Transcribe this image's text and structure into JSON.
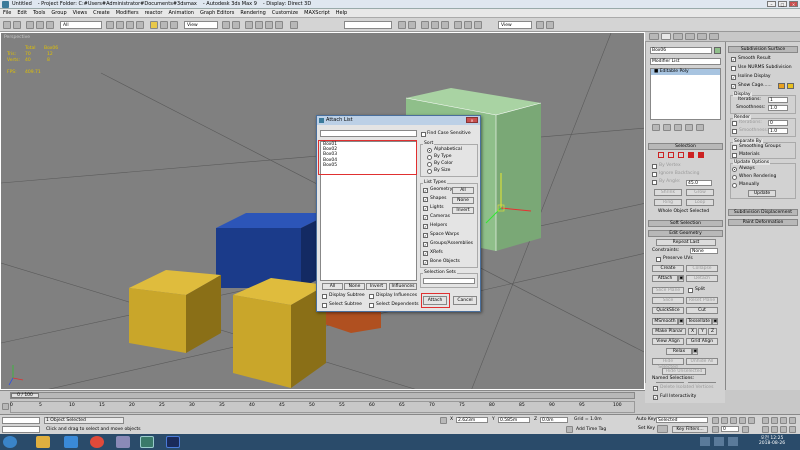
{
  "window": {
    "title_parts": [
      "Untitled",
      "- Project Folder: C:#Users#Administrator#Documents#3dsmax",
      "- Autodesk 3ds Max 9",
      "- Display: Direct 3D"
    ]
  },
  "menu": [
    "File",
    "Edit",
    "Tools",
    "Group",
    "Views",
    "Create",
    "Modifiers",
    "reactor",
    "Animation",
    "Graph Editors",
    "Rendering",
    "Customize",
    "MAXScript",
    "Help"
  ],
  "toolbar": {
    "selection_filter": "All",
    "ref_coord": "View",
    "named_set": "",
    "view_right": "View"
  },
  "viewport": {
    "label": "Perspective",
    "stats": {
      "total_label": "Total",
      "object_name": "Box06",
      "tris_label": "Tris:",
      "tris_total": "70",
      "tris_sel": "12",
      "verts_label": "Verts:",
      "verts_total": "40",
      "verts_sel": "8",
      "fps_label": "FPS:",
      "fps_value": "409.71"
    }
  },
  "modify_panel": {
    "object_name": "Box06",
    "modifier_list": "Modifier List",
    "stack_item": "Editable Poly",
    "selection_title": "Selection",
    "by_vertex": "By Vertex",
    "ignore_backfacing": "Ignore Backfacing",
    "by_angle": "By Angle:",
    "by_angle_value": "45.0",
    "shrink": "Shrink",
    "grow": "Grow",
    "ring": "Ring",
    "loop": "Loop",
    "selection_status": "Whole Object Selected",
    "soft_selection": "Soft Selection",
    "edit_geometry": "Edit Geometry",
    "repeat_last": "Repeat Last",
    "constraints_label": "Constraints:",
    "constraints_value": "None",
    "preserve_uvs": "Preserve UVs",
    "create": "Create",
    "collapse": "Collapse",
    "attach": "Attach",
    "detach": "Detach",
    "slice_plane": "Slice Plane",
    "split": "Split",
    "slice": "Slice",
    "reset_plane": "Reset Plane",
    "quickslice": "QuickSlice",
    "cut": "Cut",
    "msmooth": "MSmooth",
    "tessellate": "Tessellate",
    "make_planar": "Make Planar",
    "x": "X",
    "y": "Y",
    "z": "Z",
    "view_align": "View Align",
    "grid_align": "Grid Align",
    "relax": "Relax",
    "hide_selected": "Hide Selected",
    "unhide_all": "Unhide All",
    "hide_unselected": "Hide Unselected",
    "named_selections": "Named Selections:",
    "copy": "Copy",
    "paste": "Paste",
    "delete_isolated": "Delete Isolated Vertices",
    "full_interactivity": "Full Interactivity"
  },
  "subdivision_panel": {
    "title": "Subdivision Surface",
    "smooth_result": "Smooth Result",
    "use_nurms": "Use NURMS Subdivision",
    "isoline_display": "Isoline Display",
    "show_cage": "Show Cage......",
    "display_label": "Display",
    "iterations_label": "Iterations:",
    "iterations_value": "1",
    "smoothness_label": "Smoothness:",
    "smoothness_value": "1.0",
    "render_label": "Render",
    "render_iterations_value": "0",
    "render_smoothness_value": "1.0",
    "separate_by": "Separate By",
    "smoothing_groups": "Smoothing Groups",
    "materials": "Materials",
    "update_options": "Update Options",
    "always": "Always",
    "when_rendering": "When Rendering",
    "manually": "Manually",
    "update": "Update",
    "subdivision_displacement": "Subdivision Displacement",
    "paint_deformation": "Paint Deformation"
  },
  "dialog": {
    "title": "Attach List",
    "search_value": "",
    "find_case_sensitive": "Find Case Sensitive",
    "objects": [
      "Box01",
      "Box02",
      "Box03",
      "Box04",
      "Box05"
    ],
    "sort_label": "Sort",
    "sort_options": [
      "Alphabetical",
      "By Type",
      "By Color",
      "By Size"
    ],
    "sort_selected": "Alphabetical",
    "list_types_label": "List Types",
    "types": [
      "Geometry",
      "Shapes",
      "Lights",
      "Cameras",
      "Helpers",
      "Space Warps",
      "Groups/Assemblies",
      "XRefs",
      "Bone Objects"
    ],
    "type_all": "All",
    "type_none": "None",
    "type_invert": "Invert",
    "btn_all": "All",
    "btn_none": "None",
    "btn_invert": "Invert",
    "btn_influences": "Influences",
    "display_subtree": "Display Subtree",
    "select_subtree": "Select Subtree",
    "display_influences": "Display Influences",
    "select_dependents": "Select Dependents",
    "selection_sets_label": "Selection Sets",
    "attach_button": "Attach",
    "cancel_button": "Cancel"
  },
  "timeline": {
    "frame_display": "0 / 100",
    "ticks": [
      "0",
      "5",
      "10",
      "15",
      "20",
      "25",
      "30",
      "35",
      "40",
      "45",
      "50",
      "55",
      "60",
      "65",
      "70",
      "75",
      "80",
      "85",
      "90",
      "95",
      "100"
    ]
  },
  "status": {
    "selection_count": "1 Object Selected",
    "prompt": "Click and drag to select and move objects",
    "x_label": "X",
    "x_value": "2.623m",
    "y_label": "Y",
    "y_value": "0.585m",
    "z_label": "Z",
    "z_value": "0.0m",
    "grid": "Grid = 1.0m",
    "add_time_tag": "Add Time Tag",
    "auto_key": "Auto Key",
    "auto_key_value": "Selected",
    "set_key": "Set Key",
    "key_filters": "Key Filters...",
    "frame": "0"
  },
  "taskbar": {
    "time": "오전 12:25",
    "date": "2018-08-26"
  },
  "colors": {
    "viewport_bg": "#808080",
    "box_yellow": "#c9a62a",
    "box_blue": "#1b3b8a",
    "box_green": "#8fbf8a",
    "highlight_red": "#e03030"
  }
}
